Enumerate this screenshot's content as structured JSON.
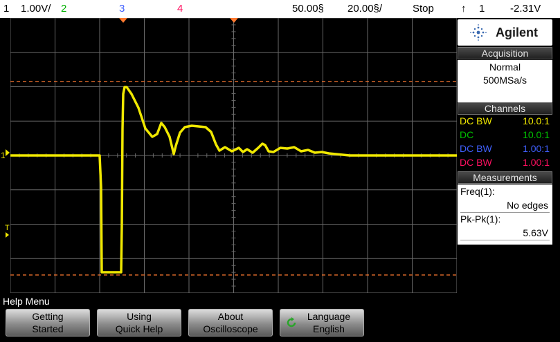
{
  "top_bar": {
    "ch1_num": "1",
    "ch1_scale": "1.00V/",
    "ch2_num": "2",
    "ch3_num": "3",
    "ch4_num": "4",
    "time_delay": "50.00§",
    "time_scale": "20.00§/",
    "run_state": "Stop",
    "trigger_channel": "1",
    "trigger_level": "-2.31V"
  },
  "side_panel": {
    "brand": "Agilent",
    "acquisition": {
      "header": "Acquisition",
      "mode": "Normal",
      "rate": "500MSa/s"
    },
    "channels": {
      "header": "Channels",
      "rows": [
        {
          "coupling": "DC BW",
          "probe": "10.0:1",
          "color": "#f0e800"
        },
        {
          "coupling": "DC",
          "probe": "10.0:1",
          "color": "#00c000"
        },
        {
          "coupling": "DC BW",
          "probe": "1.00:1",
          "color": "#4060ff"
        },
        {
          "coupling": "DC BW",
          "probe": "1.00:1",
          "color": "#ff1060"
        }
      ]
    },
    "measurements": {
      "header": "Measurements",
      "items": [
        {
          "label": "Freq(1):",
          "value": "No edges"
        },
        {
          "label": "Pk-Pk(1):",
          "value": "5.63V"
        }
      ]
    }
  },
  "screen": {
    "ground_marker": "1",
    "trigger_marker": "T"
  },
  "help_menu": {
    "title": "Help Menu",
    "softkeys": [
      {
        "line1": "Getting",
        "line2": "Started"
      },
      {
        "line1": "Using",
        "line2": "Quick Help"
      },
      {
        "line1": "About",
        "line2": "Oscilloscope"
      },
      {
        "line1": "Language",
        "line2": "English"
      }
    ]
  },
  "colors": {
    "ch1": "#f0e800",
    "ch2": "#00c000",
    "ch3": "#4060ff",
    "ch4": "#ff1060",
    "cursor": "#ff7a30",
    "grid": "#6a6a6a"
  }
}
